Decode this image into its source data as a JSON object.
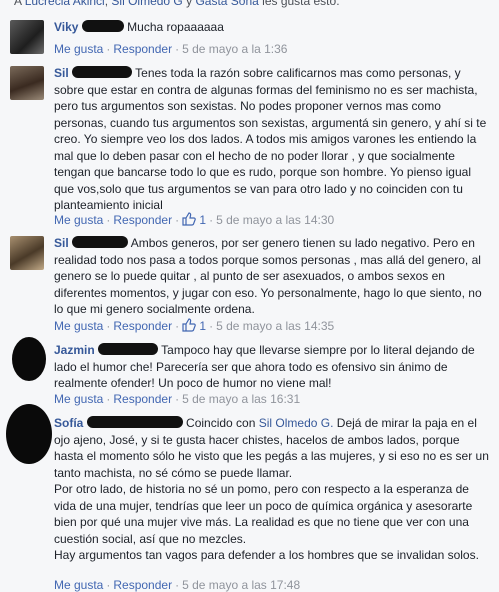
{
  "top_line": {
    "prefix": "A ",
    "name1": "Lucrecia Akinci",
    "sep1": ", ",
    "name2": "Sil Olmedo G",
    "sep2": " y ",
    "name3": "Gasta Sona",
    "suffix": " les gusta esto."
  },
  "actions": {
    "like": "Me gusta",
    "reply": "Responder",
    "dot": "·"
  },
  "comments": [
    {
      "author": "Viky",
      "text": "Mucha ropaaaaaa",
      "time": "5 de mayo a la 1:36",
      "likes": null
    },
    {
      "author": "Sil",
      "text": "Tenes toda la razón sobre calificarnos mas como personas, y sobre que estar en contra de algunas formas del feminismo no es ser machista, pero tus argumentos son sexistas. No podes proponer vernos mas como personas, cuando tus argumentos son sexistas, argumentá sin genero, y ahí si te creo. Yo siempre veo los dos lados. A todos mis amigos varones les entiendo la mal que lo deben pasar con el hecho de no poder llorar , y que socialmente tengan que bancarse todo lo que es rudo, porque son hombre. Yo pienso igual que vos,solo que tus argumentos se van para otro lado y no coinciden con tu planteamiento inicial",
      "time": "5 de mayo a las 14:30",
      "likes": "1"
    },
    {
      "author": "Sil",
      "text": "Ambos generos, por ser genero tienen su lado negativo. Pero en realidad todo nos pasa a todos porque somos personas , mas allá del genero, al genero se lo puede quitar , al punto de ser asexuados, o ambos sexos en diferentes momentos, y jugar con eso. Yo personalmente, hago lo que siento, no lo que mi genero socialmente ordena.",
      "time": "5 de mayo a las 14:35",
      "likes": "1"
    },
    {
      "author": "Jazmin",
      "text": "Tampoco hay que llevarse siempre por lo literal dejando de lado el humor che! Parecería ser que ahora todo es ofensivo sin ánimo de realmente ofender! Un poco de humor no viene mal!",
      "time": "5 de mayo a las 16:31",
      "likes": null
    },
    {
      "author": "Sofía",
      "pre_mention": "Coincido con ",
      "mention": "Sil Olmedo G.",
      "text": " Dejá de mirar la paja en el ojo ajeno, José, y si te gusta hacer chistes, hacelos de ambos lados, porque hasta el momento sólo he visto que les pegás a las mujeres, y si eso no es ser un tanto machista, no sé cómo se puede llamar.",
      "text2": "Por otro lado, de historia no sé un pomo, pero con respecto a la esperanza de vida de una mujer, tendrías que leer un poco de química orgánica y asesorarte bien por qué una mujer vive más. La realidad es que no tiene que ver con una cuestión social, así que no mezcles.",
      "text3": "Hay argumentos tan vagos para defender a los hombres que se invalidan solos.",
      "time": "5 de mayo a las 17:48",
      "likes": null
    }
  ]
}
